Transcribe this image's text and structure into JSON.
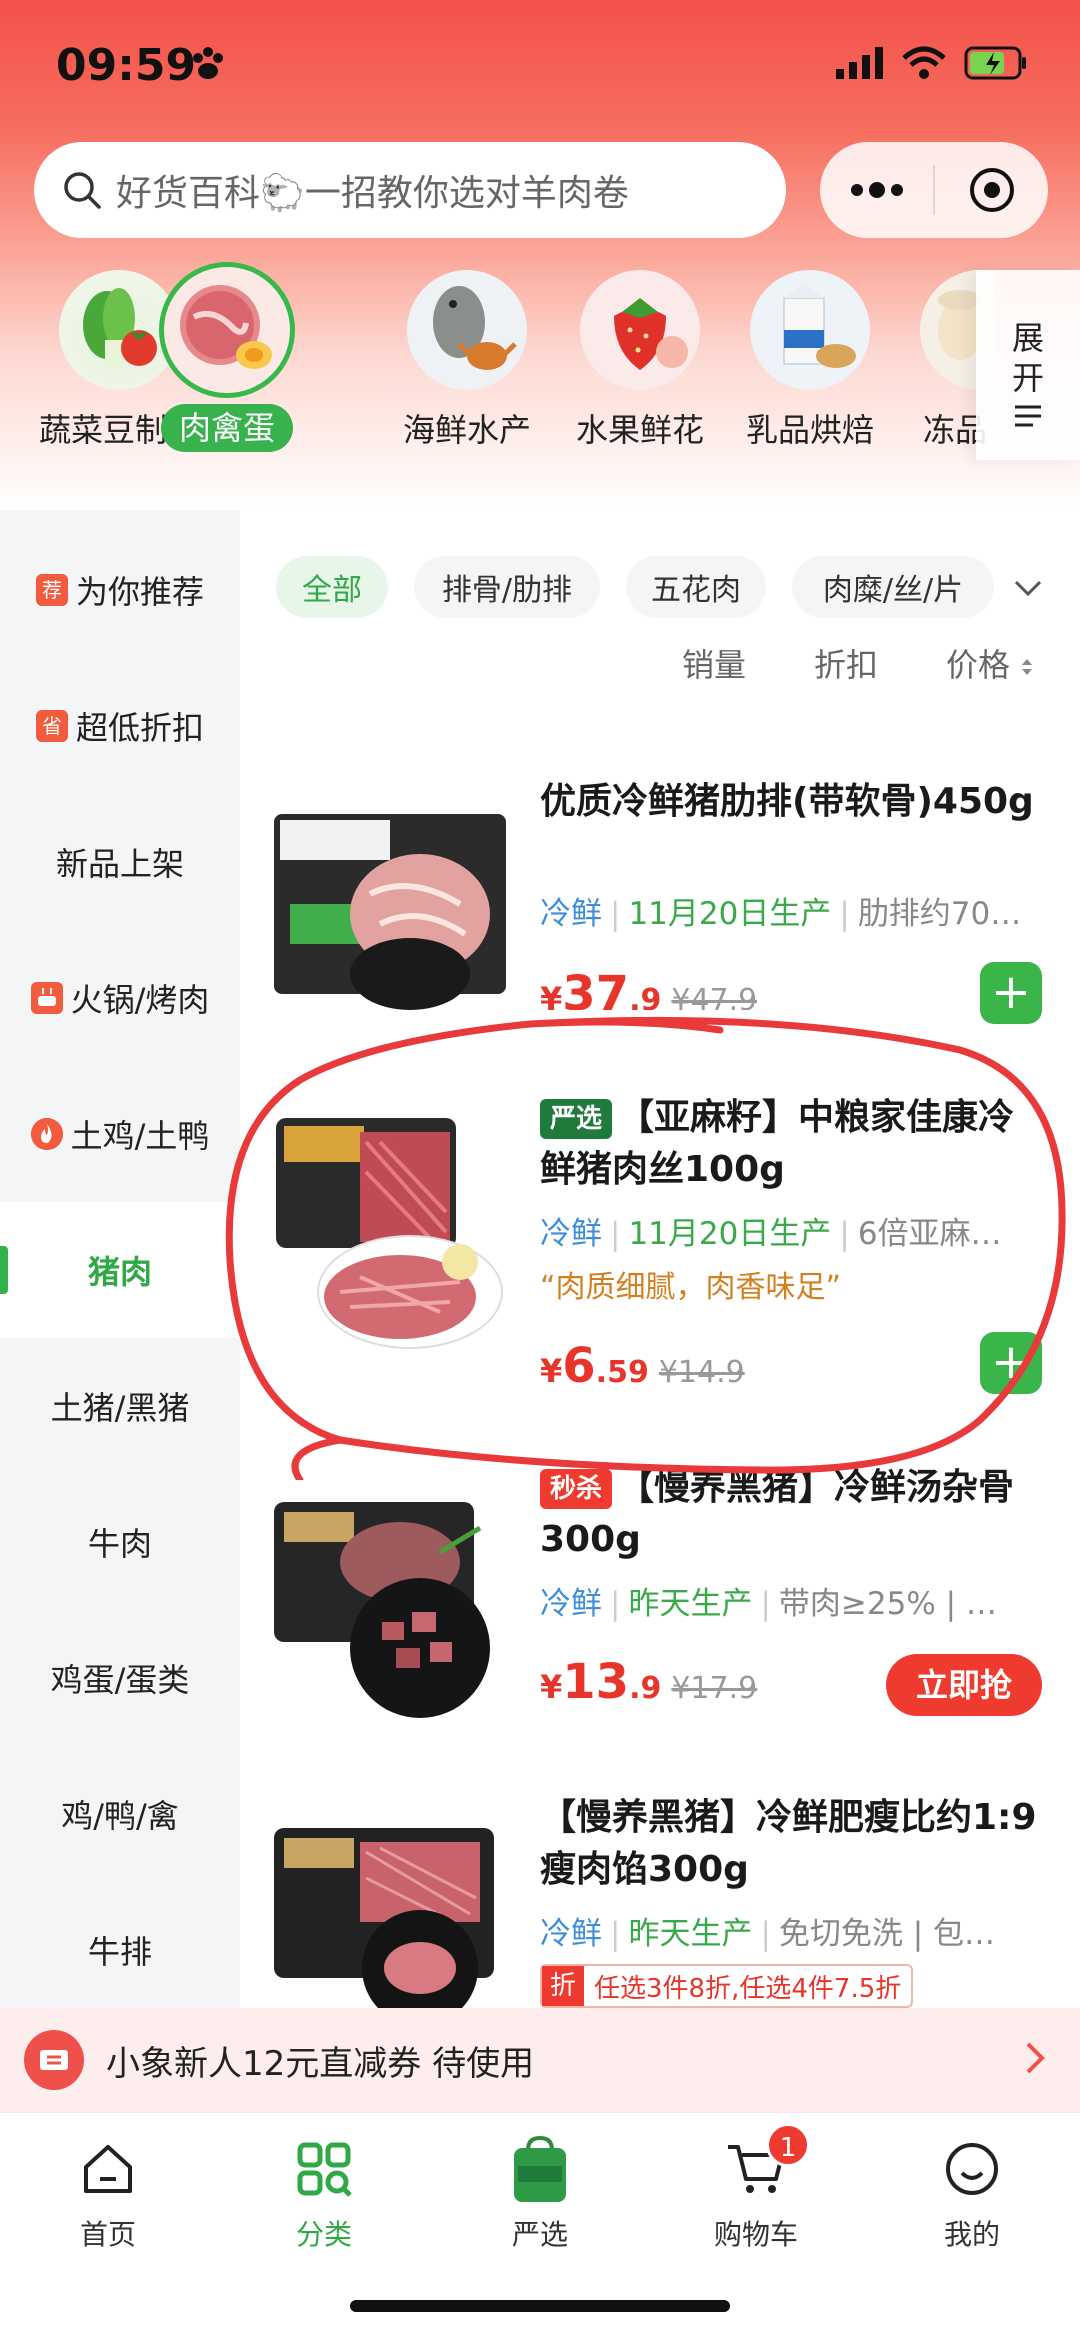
{
  "status": {
    "time": "09:59"
  },
  "search": {
    "placeholder": "好货百科🐑一招教你选对羊肉卷"
  },
  "expand": {
    "label_1": "展",
    "label_2": "开"
  },
  "categories": [
    {
      "label": "蔬菜豆制品"
    },
    {
      "label": "肉禽蛋"
    },
    {
      "label": "海鲜水产"
    },
    {
      "label": "水果鲜花"
    },
    {
      "label": "乳品烘焙"
    },
    {
      "label": "冻品"
    }
  ],
  "sidebar": [
    {
      "label": "为你推荐",
      "tag": "荐"
    },
    {
      "label": "超低折扣",
      "tag": "省"
    },
    {
      "label": "新品上架"
    },
    {
      "label": "火锅/烤肉"
    },
    {
      "label": "土鸡/土鸭"
    },
    {
      "label": "猪肉"
    },
    {
      "label": "土猪/黑猪"
    },
    {
      "label": "牛肉"
    },
    {
      "label": "鸡蛋/蛋类"
    },
    {
      "label": "鸡/鸭/禽"
    },
    {
      "label": "牛排"
    }
  ],
  "filters": [
    "全部",
    "排骨/肋排",
    "五花肉",
    "肉糜/丝/片"
  ],
  "sorts": {
    "sales": "销量",
    "discount": "折扣",
    "price": "价格"
  },
  "products": [
    {
      "title": "优质冷鲜猪肋排(带软骨)450g",
      "fresh": "冷鲜",
      "date": "11月20日生产",
      "spec": "肋排约70…",
      "price_cur": "¥",
      "price_int": "37",
      "price_dec": ".9",
      "old_price": "¥47.9"
    },
    {
      "badge": "严选",
      "title": "【亚麻籽】中粮家佳康冷鲜猪肉丝100g",
      "fresh": "冷鲜",
      "date": "11月20日生产",
      "spec": "6倍亚麻…",
      "quote": "“肉质细腻，肉香味足”",
      "price_cur": "¥",
      "price_int": "6",
      "price_dec": ".59",
      "old_price": "¥14.9"
    },
    {
      "badge": "秒杀",
      "title": "【慢养黑猪】冷鲜汤杂骨300g",
      "fresh": "冷鲜",
      "date": "昨天生产",
      "spec": "带肉≥25% | …",
      "price_cur": "¥",
      "price_int": "13",
      "price_dec": ".9",
      "old_price": "¥17.9",
      "action": "立即抢"
    },
    {
      "title": "【慢养黑猪】冷鲜肥瘦比约1:9瘦肉馅300g",
      "fresh": "冷鲜",
      "date": "昨天生产",
      "spec": "免切免洗 | 包…",
      "promo_tag": "折",
      "promo": "任选3件8折,任选4件7.5折"
    }
  ],
  "coupon": {
    "text": "小象新人12元直减券 待使用"
  },
  "tabs": [
    {
      "label": "首页"
    },
    {
      "label": "分类"
    },
    {
      "label": "严选"
    },
    {
      "label": "购物车",
      "badge": "1"
    },
    {
      "label": "我的"
    }
  ],
  "colors": {
    "accent_green": "#2fa845",
    "price_red": "#e8352b",
    "header_red": "#f4514b"
  }
}
